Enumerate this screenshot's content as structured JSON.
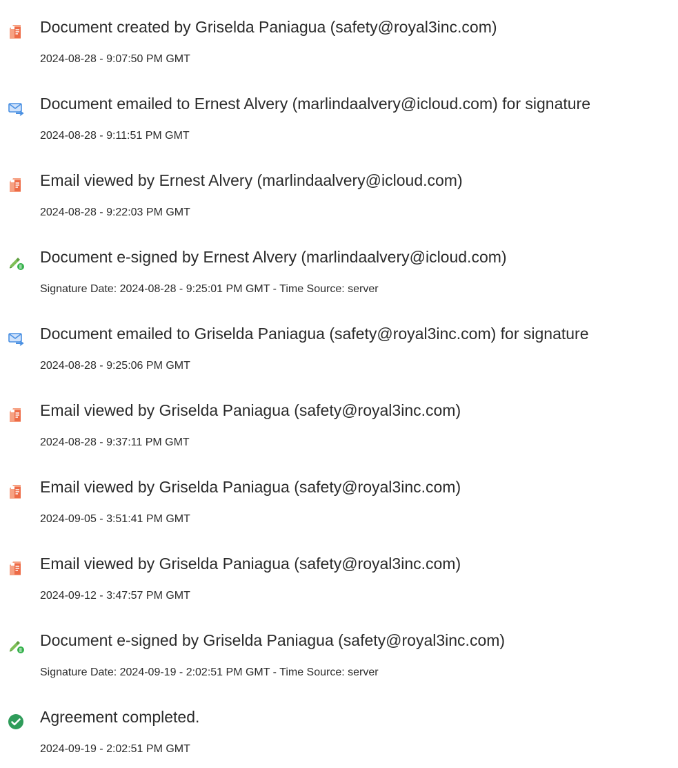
{
  "events": [
    {
      "icon": "document-pdf-icon",
      "title": "Document created by Griselda Paniagua (safety@royal3inc.com)",
      "meta": "2024-08-28 - 9:07:50 PM GMT"
    },
    {
      "icon": "email-sent-icon",
      "title": "Document emailed to Ernest Alvery (marlindaalvery@icloud.com) for signature",
      "meta": "2024-08-28 - 9:11:51 PM GMT"
    },
    {
      "icon": "document-pdf-icon",
      "title": "Email viewed by Ernest Alvery (marlindaalvery@icloud.com)",
      "meta": "2024-08-28 - 9:22:03 PM GMT"
    },
    {
      "icon": "e-sign-pen-icon",
      "title": "Document e-signed by Ernest Alvery (marlindaalvery@icloud.com)",
      "meta": "Signature Date: 2024-08-28 - 9:25:01 PM GMT - Time Source: server"
    },
    {
      "icon": "email-sent-icon",
      "title": "Document emailed to Griselda Paniagua (safety@royal3inc.com) for signature",
      "meta": "2024-08-28 - 9:25:06 PM GMT"
    },
    {
      "icon": "document-pdf-icon",
      "title": "Email viewed by Griselda Paniagua (safety@royal3inc.com)",
      "meta": "2024-08-28 - 9:37:11 PM GMT"
    },
    {
      "icon": "document-pdf-icon",
      "title": "Email viewed by Griselda Paniagua (safety@royal3inc.com)",
      "meta": "2024-09-05 - 3:51:41 PM GMT"
    },
    {
      "icon": "document-pdf-icon",
      "title": "Email viewed by Griselda Paniagua (safety@royal3inc.com)",
      "meta": "2024-09-12 - 3:47:57 PM GMT"
    },
    {
      "icon": "e-sign-pen-icon",
      "title": "Document e-signed by Griselda Paniagua (safety@royal3inc.com)",
      "meta": "Signature Date: 2024-09-19 - 2:02:51 PM GMT - Time Source: server"
    },
    {
      "icon": "check-circle-icon",
      "title": "Agreement completed.",
      "meta": "2024-09-19 - 2:02:51 PM GMT"
    }
  ],
  "colors": {
    "document_icon": "#ed6b47",
    "email_icon": "#4a90e2",
    "esign_icon": "#7fbf57",
    "complete_icon": "#2f9c5a"
  }
}
